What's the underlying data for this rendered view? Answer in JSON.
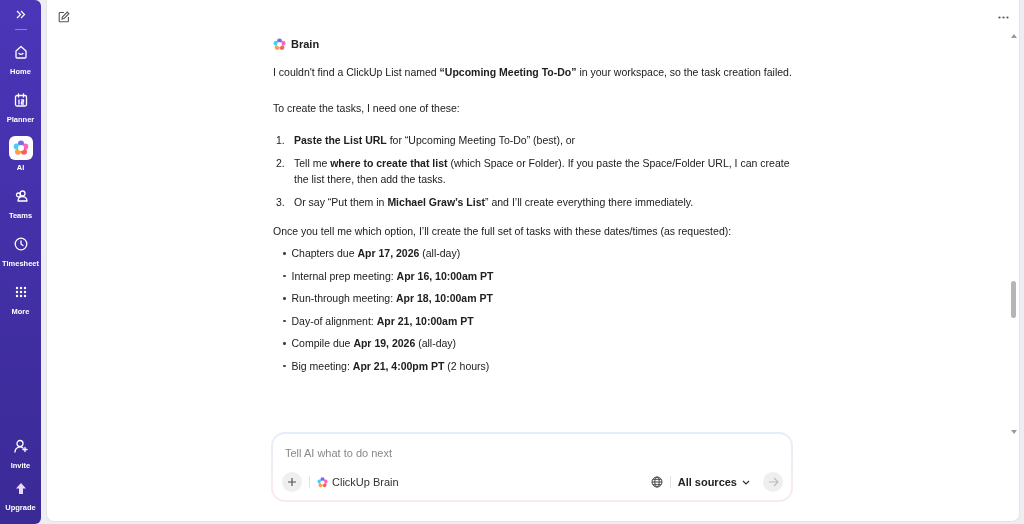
{
  "sidebar": {
    "items": [
      {
        "label": "Home",
        "selected": false
      },
      {
        "label": "Planner",
        "selected": false
      },
      {
        "label": "AI",
        "selected": true
      },
      {
        "label": "Teams",
        "selected": false
      },
      {
        "label": "Timesheet",
        "selected": false
      },
      {
        "label": "More",
        "selected": false
      }
    ],
    "bottom_items": [
      {
        "label": "Invite",
        "selected": false
      },
      {
        "label": "Upgrade",
        "selected": false
      }
    ]
  },
  "message": {
    "author": "Brain",
    "blocks": [
      {
        "kind": "paragraph",
        "text": "I couldn't find a ClickUp List named **“Upcoming Meeting To-Do”** in your workspace, so the task creation failed."
      },
      {
        "kind": "paragraph",
        "text": "To create the tasks, I need one of these:"
      },
      {
        "kind": "numbered",
        "items": [
          {
            "number": "1.",
            "text": "**Paste the List URL** for “Upcoming Meeting To-Do” (best), or"
          },
          {
            "number": "2.",
            "text": "Tell me **where to create that list** (which Space or Folder). If you paste the Space/Folder URL, I can create the list there, then add the tasks."
          },
          {
            "number": "3.",
            "text": "Or say “Put them in **Michael Graw’s List**” and I’ll create everything there immediately."
          }
        ]
      },
      {
        "kind": "paragraph",
        "text": "Once you tell me which option, I’ll create the full set of tasks with these dates/times (as requested):"
      },
      {
        "kind": "bullets",
        "items": [
          {
            "text": "Chapters due **Apr 17, 2026** (all-day)"
          },
          {
            "text": "Internal prep meeting: **Apr 16, 10:00am PT**"
          },
          {
            "text": "Run-through meeting: **Apr 18, 10:00am PT**"
          },
          {
            "text": "Day-of alignment: **Apr 21, 10:00am PT**"
          },
          {
            "text": "Compile due **Apr 19, 2026** (all-day)"
          },
          {
            "text": "Big meeting: **Apr 21, 4:00pm PT** (2 hours)"
          }
        ]
      }
    ]
  },
  "composer": {
    "placeholder": "Tell AI what to do next",
    "model": "ClickUp Brain",
    "sources": "All sources"
  }
}
